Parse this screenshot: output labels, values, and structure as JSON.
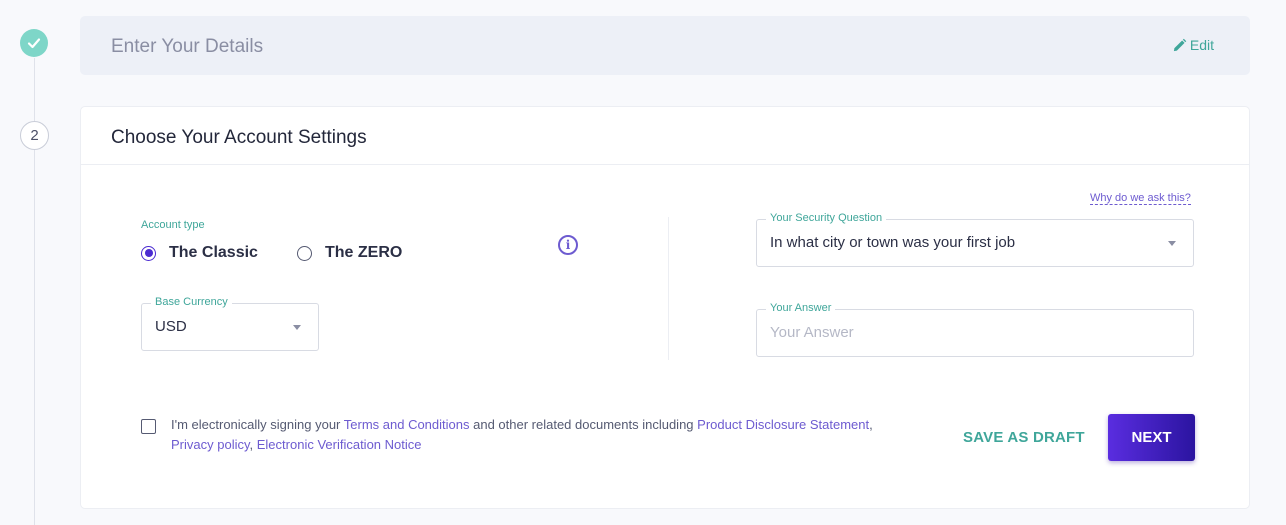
{
  "stepper": {
    "step2_number": "2"
  },
  "step1": {
    "title": "Enter Your Details",
    "edit_label": "Edit"
  },
  "step2": {
    "title": "Choose Your Account Settings",
    "account_type_label": "Account type",
    "account_types": [
      {
        "label": "The Classic",
        "selected": true
      },
      {
        "label": "The ZERO",
        "selected": false
      }
    ],
    "info_glyph": "i",
    "base_currency": {
      "label": "Base Currency",
      "value": "USD"
    },
    "why_link": "Why do we ask this?",
    "security_question": {
      "label": "Your Security Question",
      "value": "In what city or town was your first job"
    },
    "answer": {
      "label": "Your Answer",
      "placeholder": "Your Answer",
      "value": ""
    },
    "terms": {
      "prefix": "I'm electronically signing your ",
      "link1": "Terms and Conditions",
      "middle": " and other related documents including ",
      "link2": "Product Disclosure Statement",
      "sep1": ",",
      "link3": "Privacy policy",
      "sep2": ", ",
      "link4": "Electronic Verification Notice"
    },
    "save_draft_label": "SAVE AS DRAFT",
    "next_label": "NEXT"
  },
  "colors": {
    "accent_teal": "#3fa69a",
    "accent_purple": "#5a2de0",
    "step_done": "#7ed6c8"
  }
}
